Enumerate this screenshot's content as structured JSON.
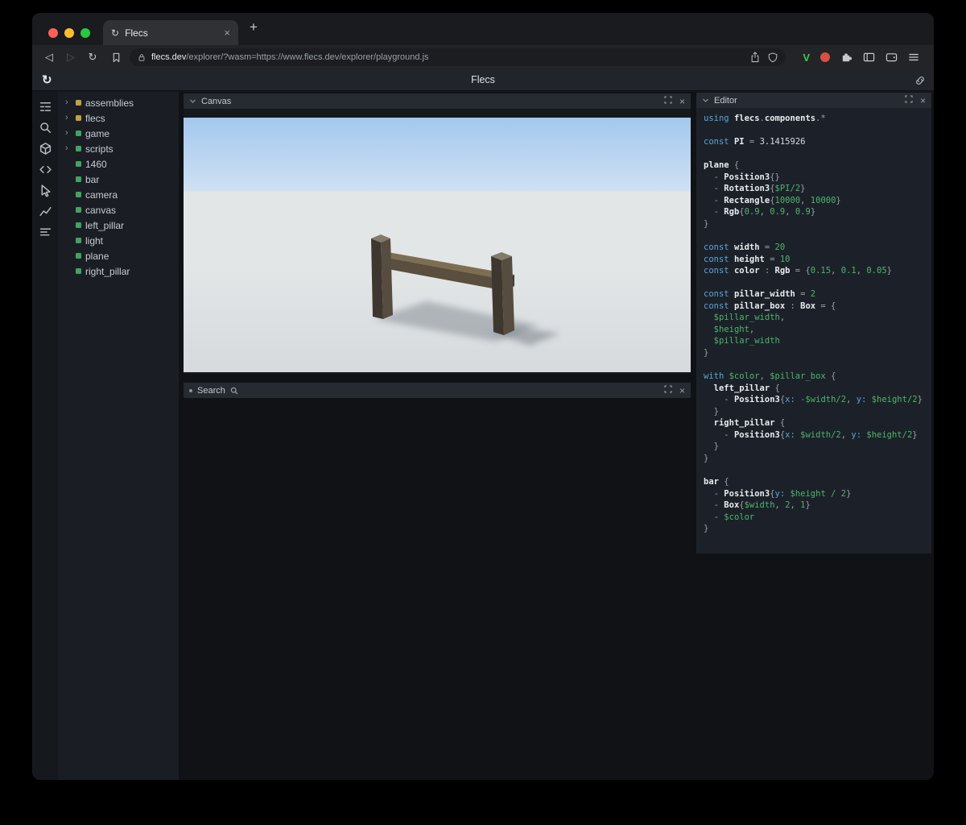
{
  "ui": {
    "close_glyph": "×",
    "chevron_right": "›"
  },
  "browser": {
    "traffic_lights": {
      "close": "#ff5f57",
      "minimize": "#febc2e",
      "zoom": "#28c840"
    },
    "tab": {
      "title": "Flecs",
      "favicon_glyph": "↻"
    },
    "new_tab_glyph": "+",
    "nav": {
      "back_glyph": "◁",
      "forward_glyph": "▷",
      "reload_glyph": "↻"
    },
    "url": {
      "host": "flecs.dev",
      "rest": "/explorer/?wasm=https://www.flecs.dev/explorer/playground.js"
    },
    "extensions": {
      "v_label": "V"
    }
  },
  "app": {
    "header": {
      "title": "Flecs",
      "logo_glyph": "↻"
    },
    "sidebar_icons": [
      "tree-view-icon",
      "search-icon",
      "cube-icon",
      "code-icon",
      "cursor-icon",
      "chart-icon",
      "rows-icon"
    ],
    "tree": {
      "items": [
        {
          "label": "assemblies",
          "arrow": true,
          "color": "#c0a33e"
        },
        {
          "label": "flecs",
          "arrow": true,
          "color": "#c0a33e"
        },
        {
          "label": "game",
          "arrow": true,
          "color": "#41a361"
        },
        {
          "label": "scripts",
          "arrow": true,
          "color": "#41a361"
        },
        {
          "label": "1460",
          "arrow": false,
          "color": "#41a361"
        },
        {
          "label": "bar",
          "arrow": false,
          "color": "#41a361"
        },
        {
          "label": "camera",
          "arrow": false,
          "color": "#41a361"
        },
        {
          "label": "canvas",
          "arrow": false,
          "color": "#41a361"
        },
        {
          "label": "left_pillar",
          "arrow": false,
          "color": "#41a361"
        },
        {
          "label": "light",
          "arrow": false,
          "color": "#41a361"
        },
        {
          "label": "plane",
          "arrow": false,
          "color": "#41a361"
        },
        {
          "label": "right_pillar",
          "arrow": false,
          "color": "#41a361"
        }
      ]
    },
    "panels": {
      "canvas": {
        "title": "Canvas"
      },
      "search": {
        "title": "Search"
      },
      "editor": {
        "title": "Editor"
      }
    },
    "scene": {
      "sky_top": "#a3c8ee",
      "sky_horizon": "#cfe0f3",
      "ground": "#e3e6e7",
      "ground_bottom": "#d6dadd",
      "pillar_front": "#564c3f",
      "pillar_side": "#3e372f",
      "pillar_top": "#837a68",
      "bar_top": "#7d6e53",
      "bar_front": "#5a4e3e",
      "bar_end": "#473d31",
      "shadow": "#6f7881"
    },
    "editor_code": {
      "colors": {
        "keyword": "#58a6d8",
        "attr": "#58a6d8",
        "identifier": "#e8ecf0",
        "punct": "#9aa0a8",
        "value": "#4db56a",
        "plain": "#d8dbe0"
      },
      "lines": [
        [
          [
            "k",
            "using "
          ],
          [
            "i",
            "flecs"
          ],
          [
            "p",
            "."
          ],
          [
            "i",
            "components"
          ],
          [
            "p",
            ".*"
          ]
        ],
        [],
        [
          [
            "k",
            "const "
          ],
          [
            "i",
            "PI"
          ],
          [
            "p",
            " = "
          ],
          [
            "n",
            "3.1415926"
          ]
        ],
        [],
        [
          [
            "i",
            "plane"
          ],
          [
            "p",
            " {"
          ]
        ],
        [
          [
            "p",
            "  - "
          ],
          [
            "i",
            "Position3"
          ],
          [
            "p",
            "{}"
          ]
        ],
        [
          [
            "p",
            "  - "
          ],
          [
            "i",
            "Rotation3"
          ],
          [
            "p",
            "{"
          ],
          [
            "v",
            "$PI/2"
          ],
          [
            "p",
            "}"
          ]
        ],
        [
          [
            "p",
            "  - "
          ],
          [
            "i",
            "Rectangle"
          ],
          [
            "p",
            "{"
          ],
          [
            "v",
            "10000"
          ],
          [
            "p",
            ", "
          ],
          [
            "v",
            "10000"
          ],
          [
            "p",
            "}"
          ]
        ],
        [
          [
            "p",
            "  - "
          ],
          [
            "i",
            "Rgb"
          ],
          [
            "p",
            "{"
          ],
          [
            "v",
            "0.9"
          ],
          [
            "p",
            ", "
          ],
          [
            "v",
            "0.9"
          ],
          [
            "p",
            ", "
          ],
          [
            "v",
            "0.9"
          ],
          [
            "p",
            "}"
          ]
        ],
        [
          [
            "p",
            "}"
          ]
        ],
        [],
        [
          [
            "k",
            "const "
          ],
          [
            "i",
            "width"
          ],
          [
            "p",
            " = "
          ],
          [
            "v",
            "20"
          ]
        ],
        [
          [
            "k",
            "const "
          ],
          [
            "i",
            "height"
          ],
          [
            "p",
            " = "
          ],
          [
            "v",
            "10"
          ]
        ],
        [
          [
            "k",
            "const "
          ],
          [
            "i",
            "color"
          ],
          [
            "p",
            " : "
          ],
          [
            "i",
            "Rgb"
          ],
          [
            "p",
            " = {"
          ],
          [
            "v",
            "0.15"
          ],
          [
            "p",
            ", "
          ],
          [
            "v",
            "0.1"
          ],
          [
            "p",
            ", "
          ],
          [
            "v",
            "0.05"
          ],
          [
            "p",
            "}"
          ]
        ],
        [],
        [
          [
            "k",
            "const "
          ],
          [
            "i",
            "pillar_width"
          ],
          [
            "p",
            " = "
          ],
          [
            "v",
            "2"
          ]
        ],
        [
          [
            "k",
            "const "
          ],
          [
            "i",
            "pillar_box"
          ],
          [
            "p",
            " : "
          ],
          [
            "i",
            "Box"
          ],
          [
            "p",
            " = {"
          ]
        ],
        [
          [
            "p",
            "  "
          ],
          [
            "v",
            "$pillar_width"
          ],
          [
            "p",
            ","
          ]
        ],
        [
          [
            "p",
            "  "
          ],
          [
            "v",
            "$height"
          ],
          [
            "p",
            ","
          ]
        ],
        [
          [
            "p",
            "  "
          ],
          [
            "v",
            "$pillar_width"
          ]
        ],
        [
          [
            "p",
            "}"
          ]
        ],
        [],
        [
          [
            "k",
            "with "
          ],
          [
            "v",
            "$color"
          ],
          [
            "p",
            ", "
          ],
          [
            "v",
            "$pillar_box"
          ],
          [
            "p",
            " {"
          ]
        ],
        [
          [
            "p",
            "  "
          ],
          [
            "i",
            "left_pillar"
          ],
          [
            "p",
            " {"
          ]
        ],
        [
          [
            "p",
            "    - "
          ],
          [
            "i",
            "Position3"
          ],
          [
            "p",
            "{"
          ],
          [
            "a",
            "x:"
          ],
          [
            "p",
            " "
          ],
          [
            "v",
            "-$width/2"
          ],
          [
            "p",
            ", "
          ],
          [
            "a",
            "y:"
          ],
          [
            "p",
            " "
          ],
          [
            "v",
            "$height/2"
          ],
          [
            "p",
            "}"
          ]
        ],
        [
          [
            "p",
            "  }"
          ]
        ],
        [
          [
            "p",
            "  "
          ],
          [
            "i",
            "right_pillar"
          ],
          [
            "p",
            " {"
          ]
        ],
        [
          [
            "p",
            "    - "
          ],
          [
            "i",
            "Position3"
          ],
          [
            "p",
            "{"
          ],
          [
            "a",
            "x:"
          ],
          [
            "p",
            " "
          ],
          [
            "v",
            "$width/2"
          ],
          [
            "p",
            ", "
          ],
          [
            "a",
            "y:"
          ],
          [
            "p",
            " "
          ],
          [
            "v",
            "$height/2"
          ],
          [
            "p",
            "}"
          ]
        ],
        [
          [
            "p",
            "  }"
          ]
        ],
        [
          [
            "p",
            "}"
          ]
        ],
        [],
        [
          [
            "i",
            "bar"
          ],
          [
            "p",
            " {"
          ]
        ],
        [
          [
            "p",
            "  - "
          ],
          [
            "i",
            "Position3"
          ],
          [
            "p",
            "{"
          ],
          [
            "a",
            "y:"
          ],
          [
            "p",
            " "
          ],
          [
            "v",
            "$height / 2"
          ],
          [
            "p",
            "}"
          ]
        ],
        [
          [
            "p",
            "  - "
          ],
          [
            "i",
            "Box"
          ],
          [
            "p",
            "{"
          ],
          [
            "v",
            "$width"
          ],
          [
            "p",
            ", "
          ],
          [
            "v",
            "2"
          ],
          [
            "p",
            ", "
          ],
          [
            "v",
            "1"
          ],
          [
            "p",
            "}"
          ]
        ],
        [
          [
            "p",
            "  - "
          ],
          [
            "v",
            "$color"
          ]
        ],
        [
          [
            "p",
            "}"
          ]
        ]
      ]
    }
  }
}
